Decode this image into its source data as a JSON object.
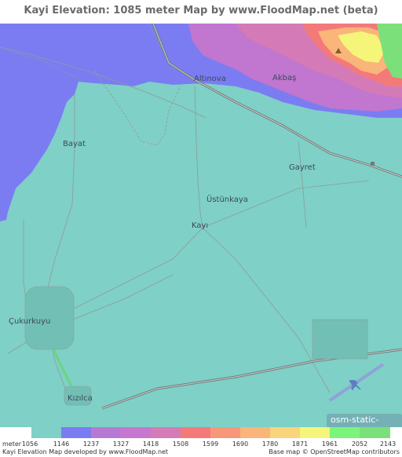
{
  "title": "Kayi Elevation: 1085 meter Map by www.FloodMap.net (beta)",
  "map": {
    "places": [
      {
        "name": "Altınova"
      },
      {
        "name": "Akbaş"
      },
      {
        "name": "Bayat"
      },
      {
        "name": "Gayret"
      },
      {
        "name": "Üstünkaya"
      },
      {
        "name": "Kayı"
      },
      {
        "name": "Çukurkuyu"
      },
      {
        "name": "Kızılca"
      }
    ],
    "watermark": "osm-static-maps",
    "colors": {
      "base": "#7fd0c6",
      "low": "#7b7cf2",
      "mid": "#c176cf",
      "high": "#f47a7a",
      "roads": "#8f9b9a",
      "highway": "#6f7a7a"
    }
  },
  "legend": {
    "unit": "meter",
    "ticks": [
      "1056",
      "1146",
      "1237",
      "1327",
      "1418",
      "1508",
      "1599",
      "1690",
      "1780",
      "1871",
      "1961",
      "2052",
      "2143"
    ],
    "colors": [
      "#7fd0c6",
      "#7b7cf2",
      "#b77ad4",
      "#c777cf",
      "#d47bb7",
      "#f47a7a",
      "#f7977a",
      "#f9b57a",
      "#f9d47a",
      "#f5f57a",
      "#7af57a",
      "#7be07a"
    ]
  },
  "footer": {
    "left": "Kayi Elevation Map developed by www.FloodMap.net",
    "right": "Base map © OpenStreetMap contributors"
  }
}
